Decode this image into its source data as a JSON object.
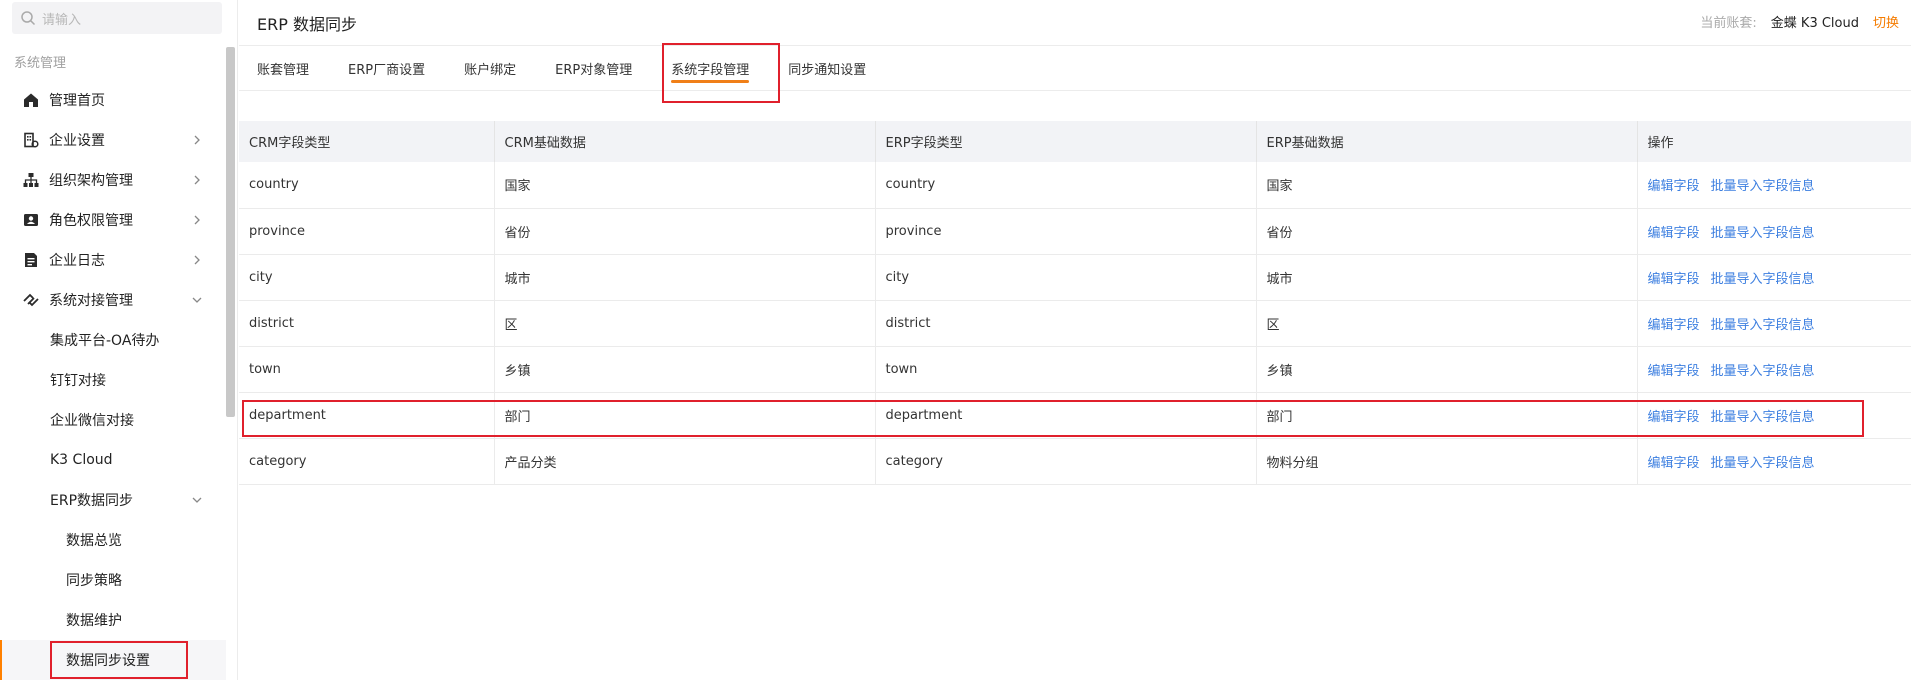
{
  "search": {
    "placeholder": "请输入"
  },
  "sidebar": {
    "group_label": "系统管理",
    "items": [
      {
        "label": "管理首页",
        "icon": "home-icon"
      },
      {
        "label": "企业设置",
        "icon": "building-icon"
      },
      {
        "label": "组织架构管理",
        "icon": "org-chart-icon"
      },
      {
        "label": "角色权限管理",
        "icon": "user-card-icon"
      },
      {
        "label": "企业日志",
        "icon": "document-icon"
      },
      {
        "label": "系统对接管理",
        "icon": "link-icon"
      }
    ],
    "sub_items": [
      "集成平台-OA待办",
      "钉钉对接",
      "企业微信对接",
      "K3 Cloud",
      "ERP数据同步"
    ],
    "sub_items2": [
      "数据总览",
      "同步策略",
      "数据维护",
      "数据同步设置"
    ]
  },
  "header": {
    "title": "ERP 数据同步",
    "account_label": "当前账套:",
    "account_name": "金蝶 K3 Cloud",
    "switch_label": "切换"
  },
  "tabs": [
    "账套管理",
    "ERP厂商设置",
    "账户绑定",
    "ERP对象管理",
    "系统字段管理",
    "同步通知设置"
  ],
  "table": {
    "columns": [
      "CRM字段类型",
      "CRM基础数据",
      "ERP字段类型",
      "ERP基础数据",
      "操作"
    ],
    "actions": {
      "edit": "编辑字段",
      "import": "批量导入字段信息"
    },
    "rows": [
      [
        "country",
        "国家",
        "country",
        "国家"
      ],
      [
        "province",
        "省份",
        "province",
        "省份"
      ],
      [
        "city",
        "城市",
        "city",
        "城市"
      ],
      [
        "district",
        "区",
        "district",
        "区"
      ],
      [
        "town",
        "乡镇",
        "town",
        "乡镇"
      ],
      [
        "department",
        "部门",
        "department",
        "部门"
      ],
      [
        "category",
        "产品分类",
        "category",
        "物料分组"
      ]
    ]
  },
  "colors": {
    "accent": "#f07f18",
    "link": "#3d7fe0",
    "highlight": "#e0202c"
  }
}
